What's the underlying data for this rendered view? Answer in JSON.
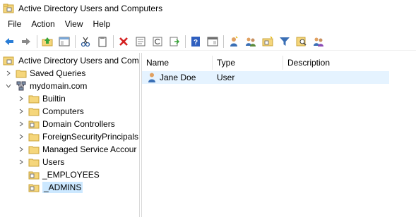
{
  "window": {
    "title": "Active Directory Users and Computers"
  },
  "menu": [
    "File",
    "Action",
    "View",
    "Help"
  ],
  "toolbar": {
    "buttons": [
      "back-icon",
      "forward-icon",
      "up-folder-icon",
      "show-hide-tree-icon",
      "cut-icon",
      "copy-icon",
      "delete-icon",
      "properties-icon",
      "refresh-icon",
      "export-list-icon",
      "help-icon",
      "console-icon",
      "new-user-icon",
      "new-group-icon",
      "new-ou-icon",
      "filter-icon",
      "find-icon",
      "add-to-group-icon"
    ]
  },
  "tree": {
    "root": "Active Directory Users and Com",
    "saved_queries": "Saved Queries",
    "domain": "mydomain.com",
    "children": [
      "Builtin",
      "Computers",
      "Domain Controllers",
      "ForeignSecurityPrincipals",
      "Managed Service Accour",
      "Users",
      "_EMPLOYEES",
      "_ADMINS"
    ],
    "selected": "_ADMINS"
  },
  "list": {
    "columns": [
      "Name",
      "Type",
      "Description"
    ],
    "rows": [
      {
        "name": "Jane Doe",
        "type": "User",
        "description": ""
      }
    ]
  },
  "colors": {
    "selection": "#cce8ff",
    "row_highlight": "#e5f3ff",
    "folder": "#f5d67b"
  }
}
